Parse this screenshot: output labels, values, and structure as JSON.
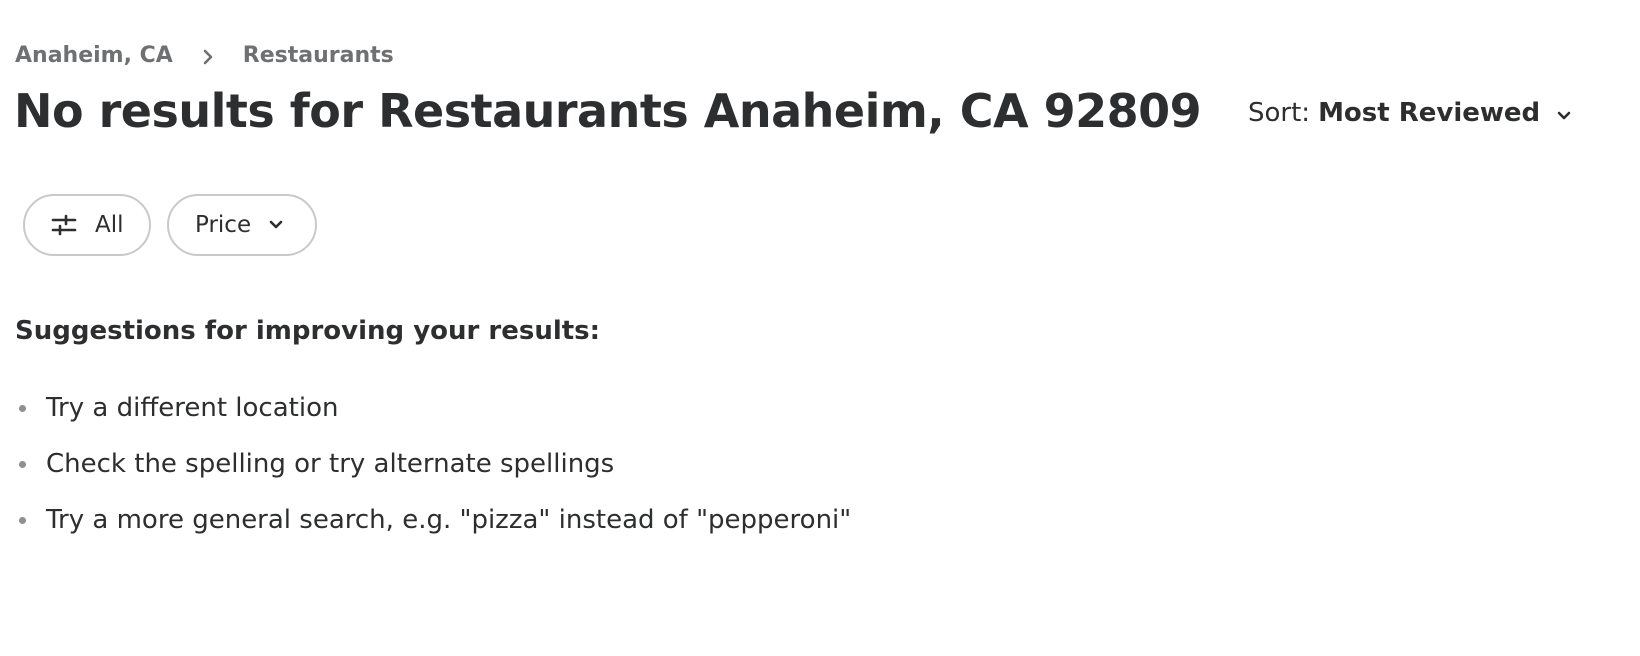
{
  "breadcrumb": {
    "location": "Anaheim, CA",
    "category": "Restaurants"
  },
  "title": "No results for Restaurants Anaheim, CA 92809",
  "sort": {
    "label": "Sort:",
    "value": "Most Reviewed"
  },
  "filters": {
    "all_label": "All",
    "price_label": "Price"
  },
  "suggestions": {
    "heading": "Suggestions for improving your results:",
    "items": [
      "Try a different location",
      "Check the spelling or try alternate spellings",
      "Try a more general search, e.g. \"pizza\" instead of \"pepperoni\""
    ]
  },
  "icons": {
    "breadcrumb_separator": "chevron-right-icon",
    "sort_dropdown": "chevron-down-icon",
    "filter_all": "sliders-icon",
    "price_dropdown": "chevron-down-icon"
  }
}
